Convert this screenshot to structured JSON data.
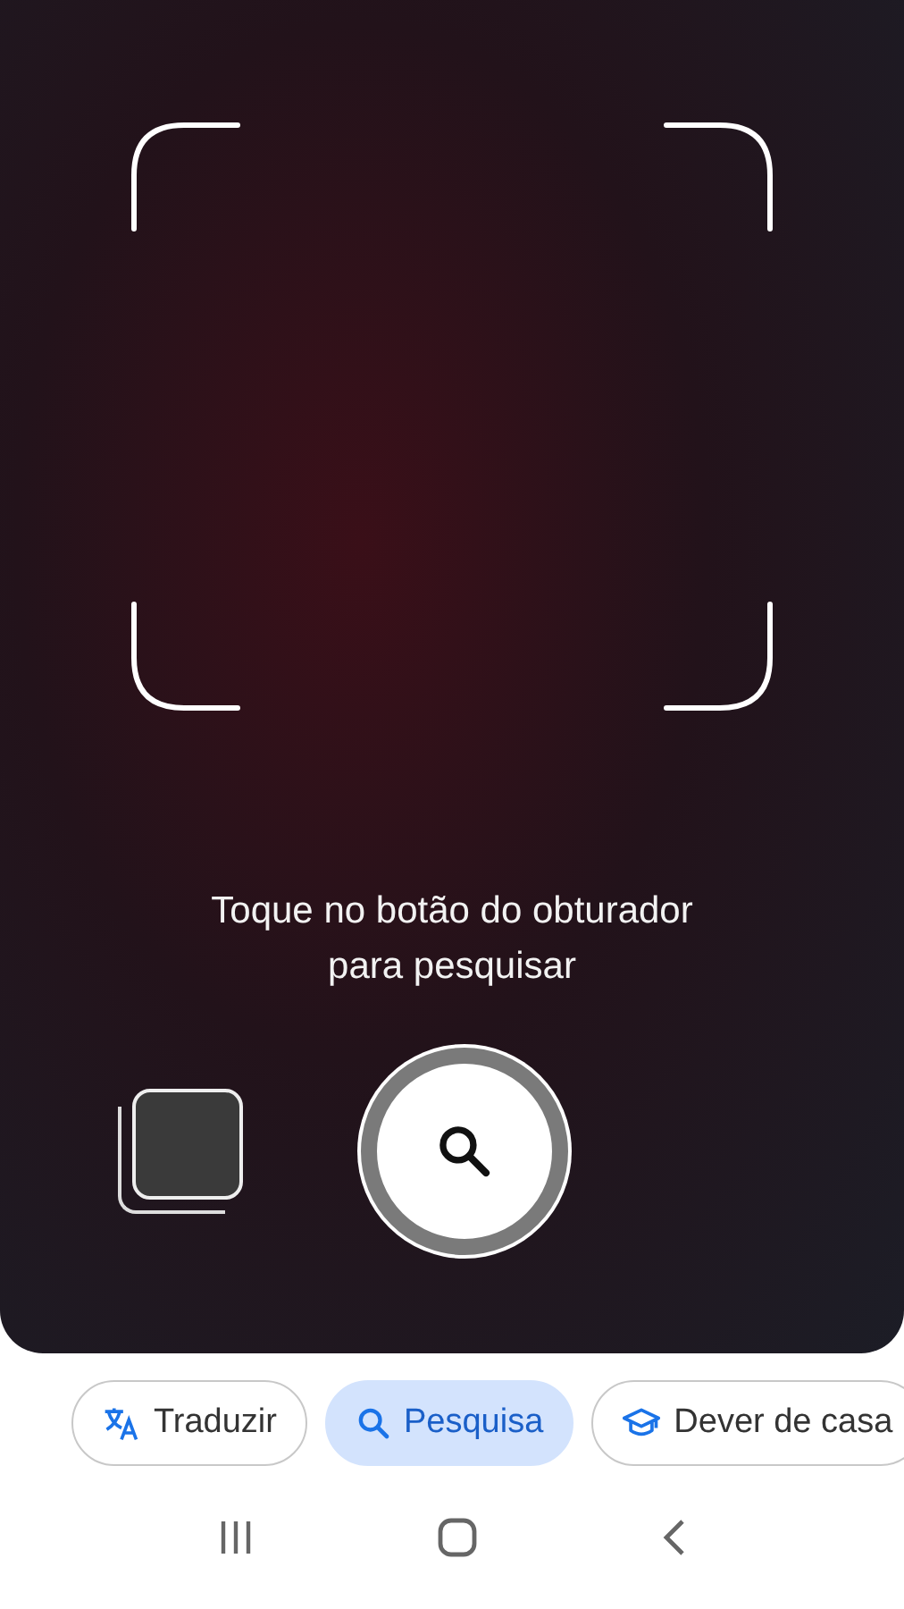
{
  "camera": {
    "hint": "Toque no botão do obturador para pesquisar"
  },
  "modes": [
    {
      "label": "Traduzir",
      "kind": "translate",
      "selected": false
    },
    {
      "label": "Pesquisa",
      "kind": "search",
      "selected": true
    },
    {
      "label": "Dever de casa",
      "kind": "homework",
      "selected": false
    }
  ]
}
